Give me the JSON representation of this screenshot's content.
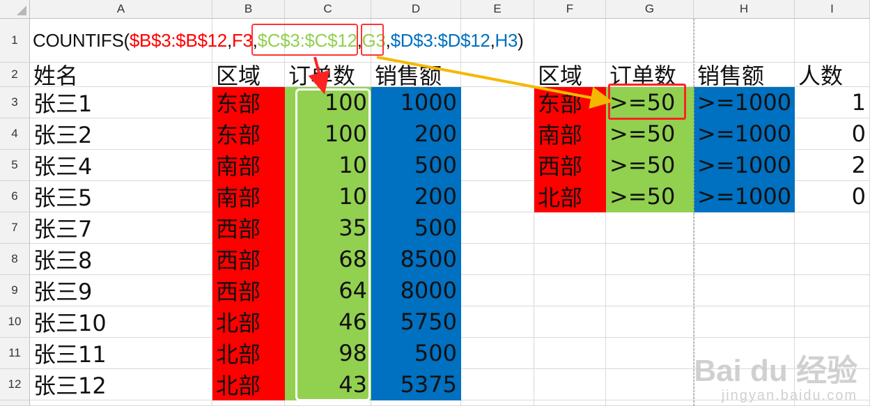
{
  "columns": [
    "A",
    "B",
    "C",
    "D",
    "E",
    "F",
    "G",
    "H",
    "I"
  ],
  "rows": [
    "1",
    "2",
    "3",
    "4",
    "5",
    "6",
    "7",
    "8",
    "9",
    "10",
    "11",
    "12",
    ""
  ],
  "formula": {
    "parts": [
      {
        "text": "COUNTIFS(",
        "color": "#111111"
      },
      {
        "text": "$B$3:$B$12",
        "color": "#ff0000"
      },
      {
        "text": ",",
        "color": "#111111"
      },
      {
        "text": "F3",
        "color": "#ff0000"
      },
      {
        "text": ",",
        "color": "#111111"
      },
      {
        "text": "$C$3:$C$12",
        "color": "#92d050"
      },
      {
        "text": ",",
        "color": "#111111"
      },
      {
        "text": "G3",
        "color": "#92d050"
      },
      {
        "text": ",",
        "color": "#111111"
      },
      {
        "text": "$D$3:$D$12",
        "color": "#0070c0"
      },
      {
        "text": ",",
        "color": "#111111"
      },
      {
        "text": "H3",
        "color": "#0070c0"
      },
      {
        "text": ")",
        "color": "#111111"
      }
    ]
  },
  "left_table": {
    "headers": [
      "姓名",
      "区域",
      "订单数",
      "销售额"
    ],
    "rows": [
      [
        "张三1",
        "东部",
        "100",
        "1000"
      ],
      [
        "张三2",
        "东部",
        "100",
        "200"
      ],
      [
        "张三4",
        "南部",
        "10",
        "500"
      ],
      [
        "张三5",
        "南部",
        "10",
        "200"
      ],
      [
        "张三7",
        "西部",
        "35",
        "500"
      ],
      [
        "张三8",
        "西部",
        "68",
        "8500"
      ],
      [
        "张三9",
        "西部",
        "64",
        "8000"
      ],
      [
        "张三10",
        "北部",
        "46",
        "5750"
      ],
      [
        "张三11",
        "北部",
        "98",
        "500"
      ],
      [
        "张三12",
        "北部",
        "43",
        "5375"
      ]
    ]
  },
  "right_table": {
    "headers": [
      "区域",
      "订单数",
      "销售额",
      "人数"
    ],
    "rows": [
      [
        "东部",
        ">=50",
        ">=1000",
        "1"
      ],
      [
        "南部",
        ">=50",
        ">=1000",
        "0"
      ],
      [
        "西部",
        ">=50",
        ">=1000",
        "2"
      ],
      [
        "北部",
        ">=50",
        ">=1000",
        "0"
      ]
    ]
  },
  "colors": {
    "red": "#ff0000",
    "green": "#92d050",
    "blue": "#0070c0",
    "arrow": "#f5b800",
    "highlight_red": "#ff3333"
  },
  "watermark": {
    "brand": "Bai du 经验",
    "url": "jingyan.baidu.com"
  }
}
